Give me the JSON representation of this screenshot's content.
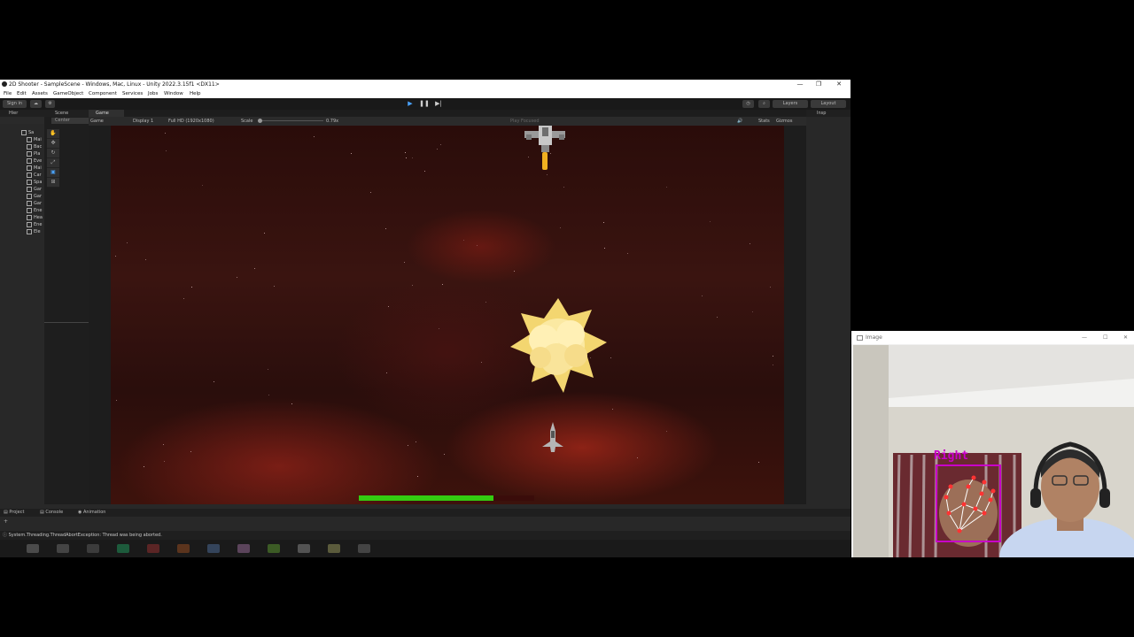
{
  "window": {
    "title": "2D Shooter - SampleScene - Windows, Mac, Linux - Unity 2022.3.15f1 <DX11>",
    "controls": [
      "—",
      "❐",
      "✕"
    ]
  },
  "menu": [
    "File",
    "Edit",
    "Assets",
    "GameObject",
    "Component",
    "Services",
    "Jobs",
    "Window",
    "Help"
  ],
  "toolbar": {
    "sign_in": "Sign in",
    "layers": "Layers",
    "layout": "Layout"
  },
  "hierarchy": {
    "tab": "Hier",
    "items": [
      "Sa",
      "Mai",
      "Bac",
      "Pla",
      "Eve",
      "Mai",
      "Car",
      "Spa",
      "Gar",
      "Gar",
      "Gar",
      "Ene",
      "Hea",
      "Ene",
      "Ele"
    ]
  },
  "scene": {
    "tab": "Scene",
    "pivot": "Center"
  },
  "game": {
    "tab": "Game",
    "mode": "Game",
    "display": "Display 1",
    "resolution": "Full HD (1920x1080)",
    "scale_label": "Scale",
    "scale_value": "0.79x",
    "play_focused": "Play Focused",
    "stats": "Stats",
    "gizmos": "Gizmos",
    "health_fraction": 0.77
  },
  "inspector": {
    "tab": "Insp"
  },
  "bottom_tabs": [
    "Project",
    "Console",
    "Animation"
  ],
  "status_message": "System.Threading.ThreadAbortException: Thread was being aborted.",
  "camera_window": {
    "title": "Image",
    "hand_label": "Right",
    "controls": [
      "—",
      "☐",
      "✕"
    ]
  },
  "colors": {
    "play_accent": "#4aa3ff",
    "health_bar": "#33cc11",
    "hand_box": "#c800c8",
    "landmark": "#ff3333"
  }
}
